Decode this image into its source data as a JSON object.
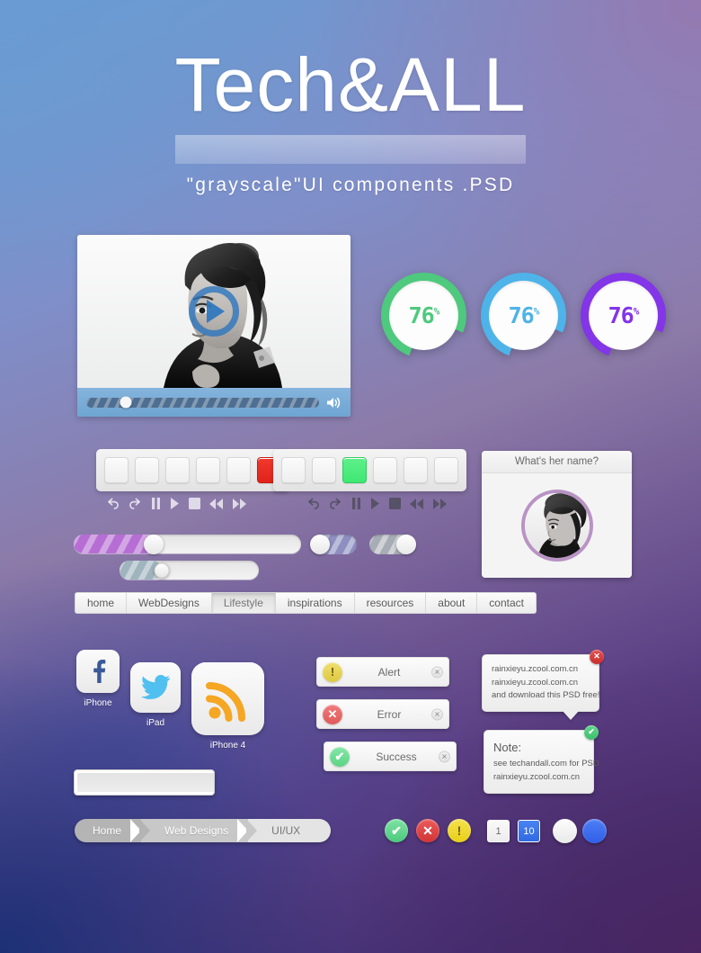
{
  "background": {
    "top_left": "#6a9bd2",
    "top_right": "#8c7aa8",
    "bottom_left": "#1e3276",
    "bottom_right": "#4a2560"
  },
  "header": {
    "title": "Tech&ALL",
    "subtitle": "\"grayscale\"UI components .PSD"
  },
  "video_player": {
    "play_icon": "play-icon",
    "volume_icon": "volume-icon",
    "progress_percent": 17
  },
  "progress_circles": [
    {
      "value": "76",
      "unit": "%",
      "color": "#4ec97d",
      "percent": 76
    },
    {
      "value": "76",
      "unit": "%",
      "color": "#4eb3e8",
      "percent": 76
    },
    {
      "value": "76",
      "unit": "%",
      "color": "#8335e8",
      "percent": 76
    }
  ],
  "button_group_1": {
    "buttons": [
      "",
      "",
      "",
      "",
      "",
      ""
    ],
    "active_index": 5,
    "active_color": "#e0231a"
  },
  "button_group_2": {
    "buttons": [
      "",
      "",
      "",
      "",
      "",
      ""
    ],
    "active_index": 2,
    "active_color": "#3ee873"
  },
  "media_controls": {
    "icons": [
      "undo-icon",
      "redo-icon",
      "pause-icon",
      "play-icon",
      "stop-icon",
      "rewind-icon",
      "fast-forward-icon"
    ]
  },
  "sliders": {
    "main": {
      "percent": 35,
      "color": "#b66ed4"
    },
    "small": {
      "percent": 30,
      "color": "#9fb4bd"
    }
  },
  "toggles": [
    {
      "state": "on",
      "knob": "left",
      "color": "#8e8fc0"
    },
    {
      "state": "off",
      "knob": "right",
      "color": "#a8adb5"
    }
  ],
  "name_card": {
    "title": "What's her name?",
    "avatar_border_color": "#b893c4"
  },
  "nav_tabs": {
    "items": [
      {
        "label": "home",
        "active": false
      },
      {
        "label": "WebDesigns",
        "active": false
      },
      {
        "label": "Lifestyle",
        "active": true
      },
      {
        "label": "inspirations",
        "active": false
      },
      {
        "label": "resources",
        "active": false
      },
      {
        "label": "about",
        "active": false
      },
      {
        "label": "contact",
        "active": false
      }
    ]
  },
  "social_icons": [
    {
      "icon": "facebook-icon",
      "label": "iPhone",
      "color": "#3b5998"
    },
    {
      "icon": "twitter-icon",
      "label": "iPad",
      "color": "#4fc0f0"
    },
    {
      "icon": "rss-icon",
      "label": "iPhone 4",
      "color": "#f5a623"
    }
  ],
  "search": {
    "value": "",
    "placeholder": "",
    "icon": "search-icon",
    "icon_color": "#5b8fc9"
  },
  "alerts": [
    {
      "type": "alert",
      "label": "Alert",
      "icon": "exclamation-icon",
      "color": "#ddc83e",
      "close_icon": "close-icon"
    },
    {
      "type": "error",
      "label": "Error",
      "icon": "cross-icon",
      "color": "#e05a5a",
      "close_icon": "close-icon"
    },
    {
      "type": "success",
      "label": "Success",
      "icon": "check-icon",
      "color": "#5cd484",
      "close_icon": "close-icon"
    }
  ],
  "tooltips": {
    "first": {
      "line1": "rainxieyu.zcool.com.cn",
      "line2": "rainxieyu.zcool.com.cn",
      "line3": "and download this PSD free!",
      "badge_icon": "close-icon",
      "badge_color": "#c92f2f",
      "badge_glyph": "✕"
    },
    "second": {
      "title": "Note:",
      "line1": "see techandall.com for PSD",
      "line2": "rainxieyu.zcool.com.cn",
      "badge_icon": "check-icon",
      "badge_color": "#3cbf6c",
      "badge_glyph": "✔"
    }
  },
  "breadcrumb": {
    "items": [
      "Home",
      "Web Designs",
      "UI/UX"
    ]
  },
  "status_badges": [
    {
      "type": "success",
      "icon": "check-icon",
      "glyph": "✔",
      "color": "#4cca7c"
    },
    {
      "type": "error",
      "icon": "cross-icon",
      "glyph": "✕",
      "color": "#d33434"
    },
    {
      "type": "warning",
      "icon": "exclamation-icon",
      "glyph": "!",
      "color": "#e8cf18"
    }
  ],
  "pagination": [
    {
      "label": "1",
      "active": false
    },
    {
      "label": "10",
      "active": true
    }
  ],
  "circle_radios": [
    {
      "state": "off",
      "color": "#f0f0f0"
    },
    {
      "state": "on",
      "color": "#2f5fe8"
    }
  ]
}
